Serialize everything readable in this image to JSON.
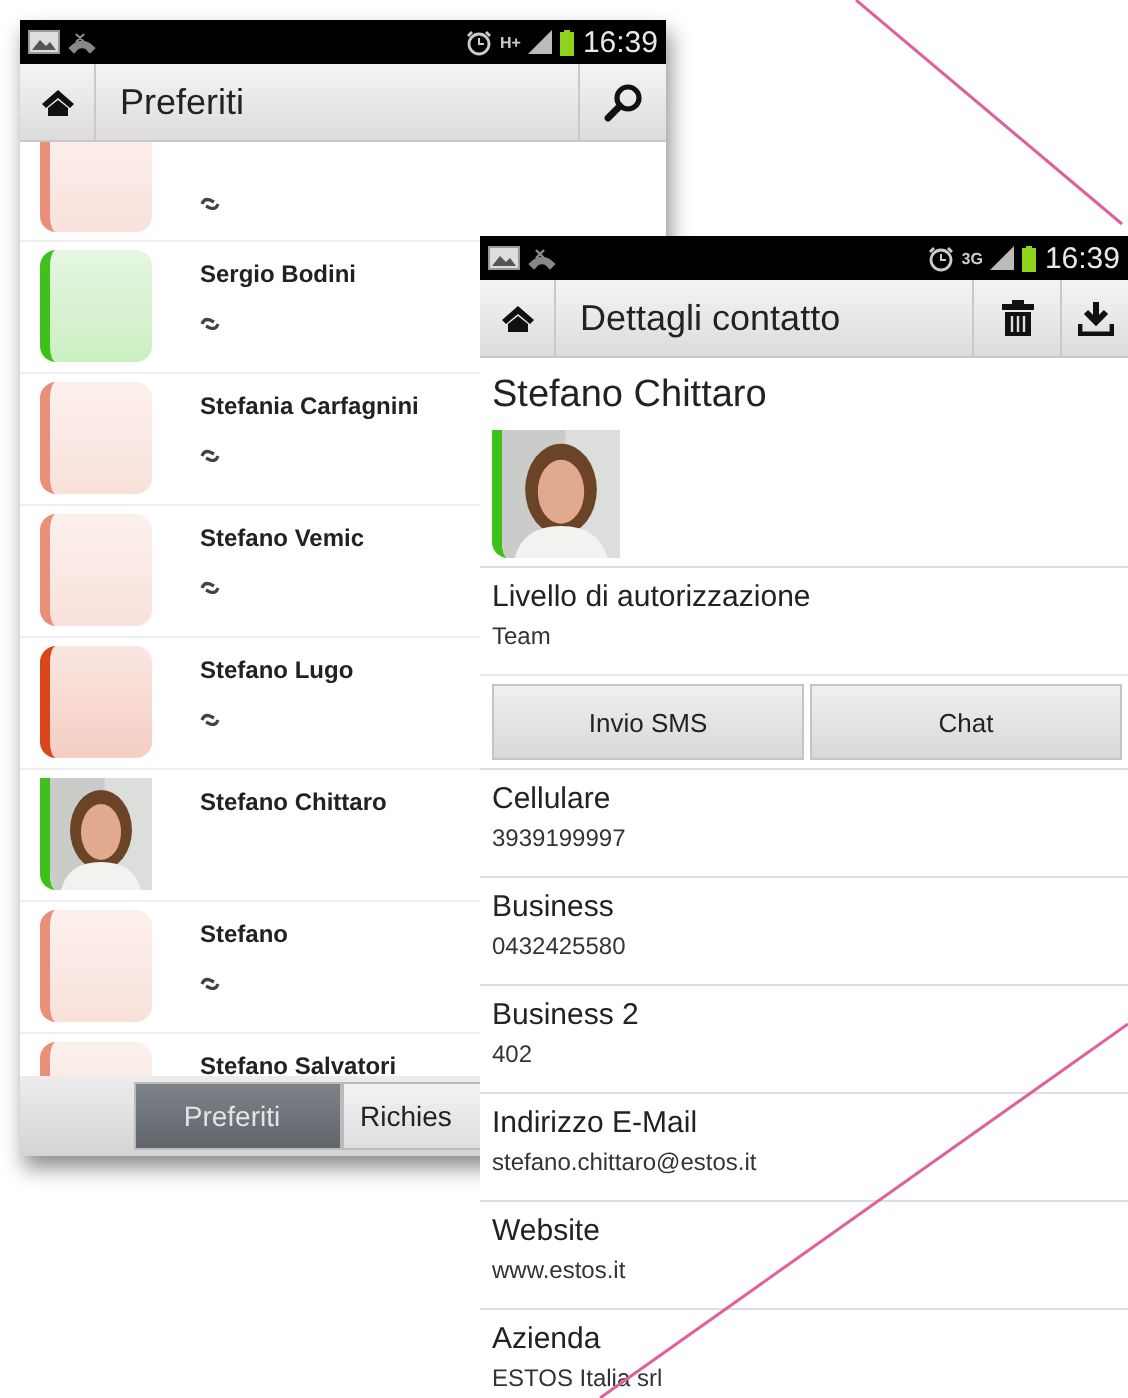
{
  "favorites_screen": {
    "status_bar": {
      "network": "H+",
      "time": "16:39"
    },
    "title": "Preferiti",
    "contacts": [
      {
        "color": "#e8907a",
        "kind": "placeholder",
        "sync": true
      },
      {
        "name": "Sergio Bodini",
        "color": "#3ec21a",
        "kind": "placeholder",
        "sync": true
      },
      {
        "name": "Stefania Carfagnini",
        "color": "#e8907a",
        "kind": "placeholder",
        "sync": true
      },
      {
        "name": "Stefano Vemic",
        "color": "#e8907a",
        "kind": "placeholder",
        "sync": true
      },
      {
        "name": "Stefano Lugo",
        "color": "#d8461a",
        "kind": "placeholder",
        "sync": true
      },
      {
        "name": "Stefano Chittaro",
        "color": "#3ec21a",
        "sync": false
      },
      {
        "name": "Stefano",
        "color": "#e8907a",
        "kind": "placeholder",
        "sync": true
      },
      {
        "name": "Stefano Salvatori",
        "color": "#e8907a",
        "kind": "placeholder",
        "sync": false
      }
    ],
    "tabs": [
      {
        "label": "Preferiti",
        "selected": true
      },
      {
        "label": "Richies",
        "selected": false
      }
    ]
  },
  "details_screen": {
    "status_bar": {
      "network": "3G",
      "time": "16:39"
    },
    "title": "Dettagli contatto",
    "contact_name": "Stefano Chittaro",
    "avatar": {
      "color": "#3ec21a"
    },
    "authorization": {
      "label": "Livello di autorizzazione",
      "value": "Team"
    },
    "actions": [
      "Invio SMS",
      "Chat"
    ],
    "fields": [
      {
        "label": "Cellulare",
        "value": "3939199997"
      },
      {
        "label": "Business",
        "value": "0432425580"
      },
      {
        "label": "Business 2",
        "value": "402"
      },
      {
        "label": "Indirizzo E-Mail",
        "value": "stefano.chittaro@estos.it"
      },
      {
        "label": "Website",
        "value": "www.estos.it"
      },
      {
        "label": "Azienda",
        "value": "ESTOS Italia srl"
      }
    ]
  }
}
